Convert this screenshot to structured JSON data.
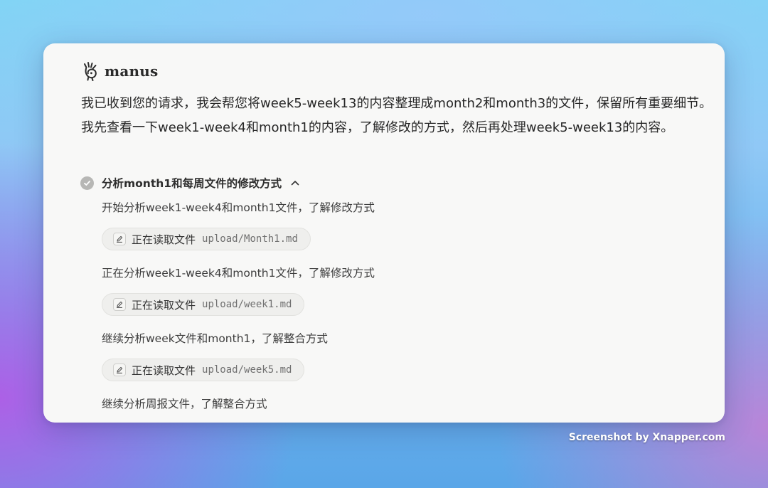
{
  "app": {
    "name": "manus",
    "logo_icon": "manus-hand-icon"
  },
  "message": {
    "text": "我已收到您的请求，我会帮您将week5-week13的内容整理成month2和month3的文件，保留所有重要细节。我先查看一下week1-week4和month1的内容，了解修改的方式，然后再处理week5-week13的内容。"
  },
  "task_step": {
    "title": "分析month1和每周文件的修改方式",
    "status": "completed",
    "expanded": true,
    "items": [
      {
        "type": "text",
        "text": "开始分析week1-week4和month1文件，了解修改方式"
      },
      {
        "type": "action",
        "label": "正在读取文件",
        "path": "upload/Month1.md",
        "icon": "edit-file-icon"
      },
      {
        "type": "text",
        "text": "正在分析week1-week4和month1文件，了解修改方式"
      },
      {
        "type": "action",
        "label": "正在读取文件",
        "path": "upload/week1.md",
        "icon": "edit-file-icon"
      },
      {
        "type": "text",
        "text": "继续分析week文件和month1，了解整合方式"
      },
      {
        "type": "action",
        "label": "正在读取文件",
        "path": "upload/week5.md",
        "icon": "edit-file-icon"
      },
      {
        "type": "text",
        "text": "继续分析周报文件，了解整合方式"
      }
    ]
  },
  "watermark": {
    "text": "Screenshot by Xnapper.com"
  },
  "colors": {
    "card_background": "#f8f8f7",
    "text_primary": "#262626",
    "check_badge": "#b7b7b5",
    "pill_background": "#efefed"
  }
}
